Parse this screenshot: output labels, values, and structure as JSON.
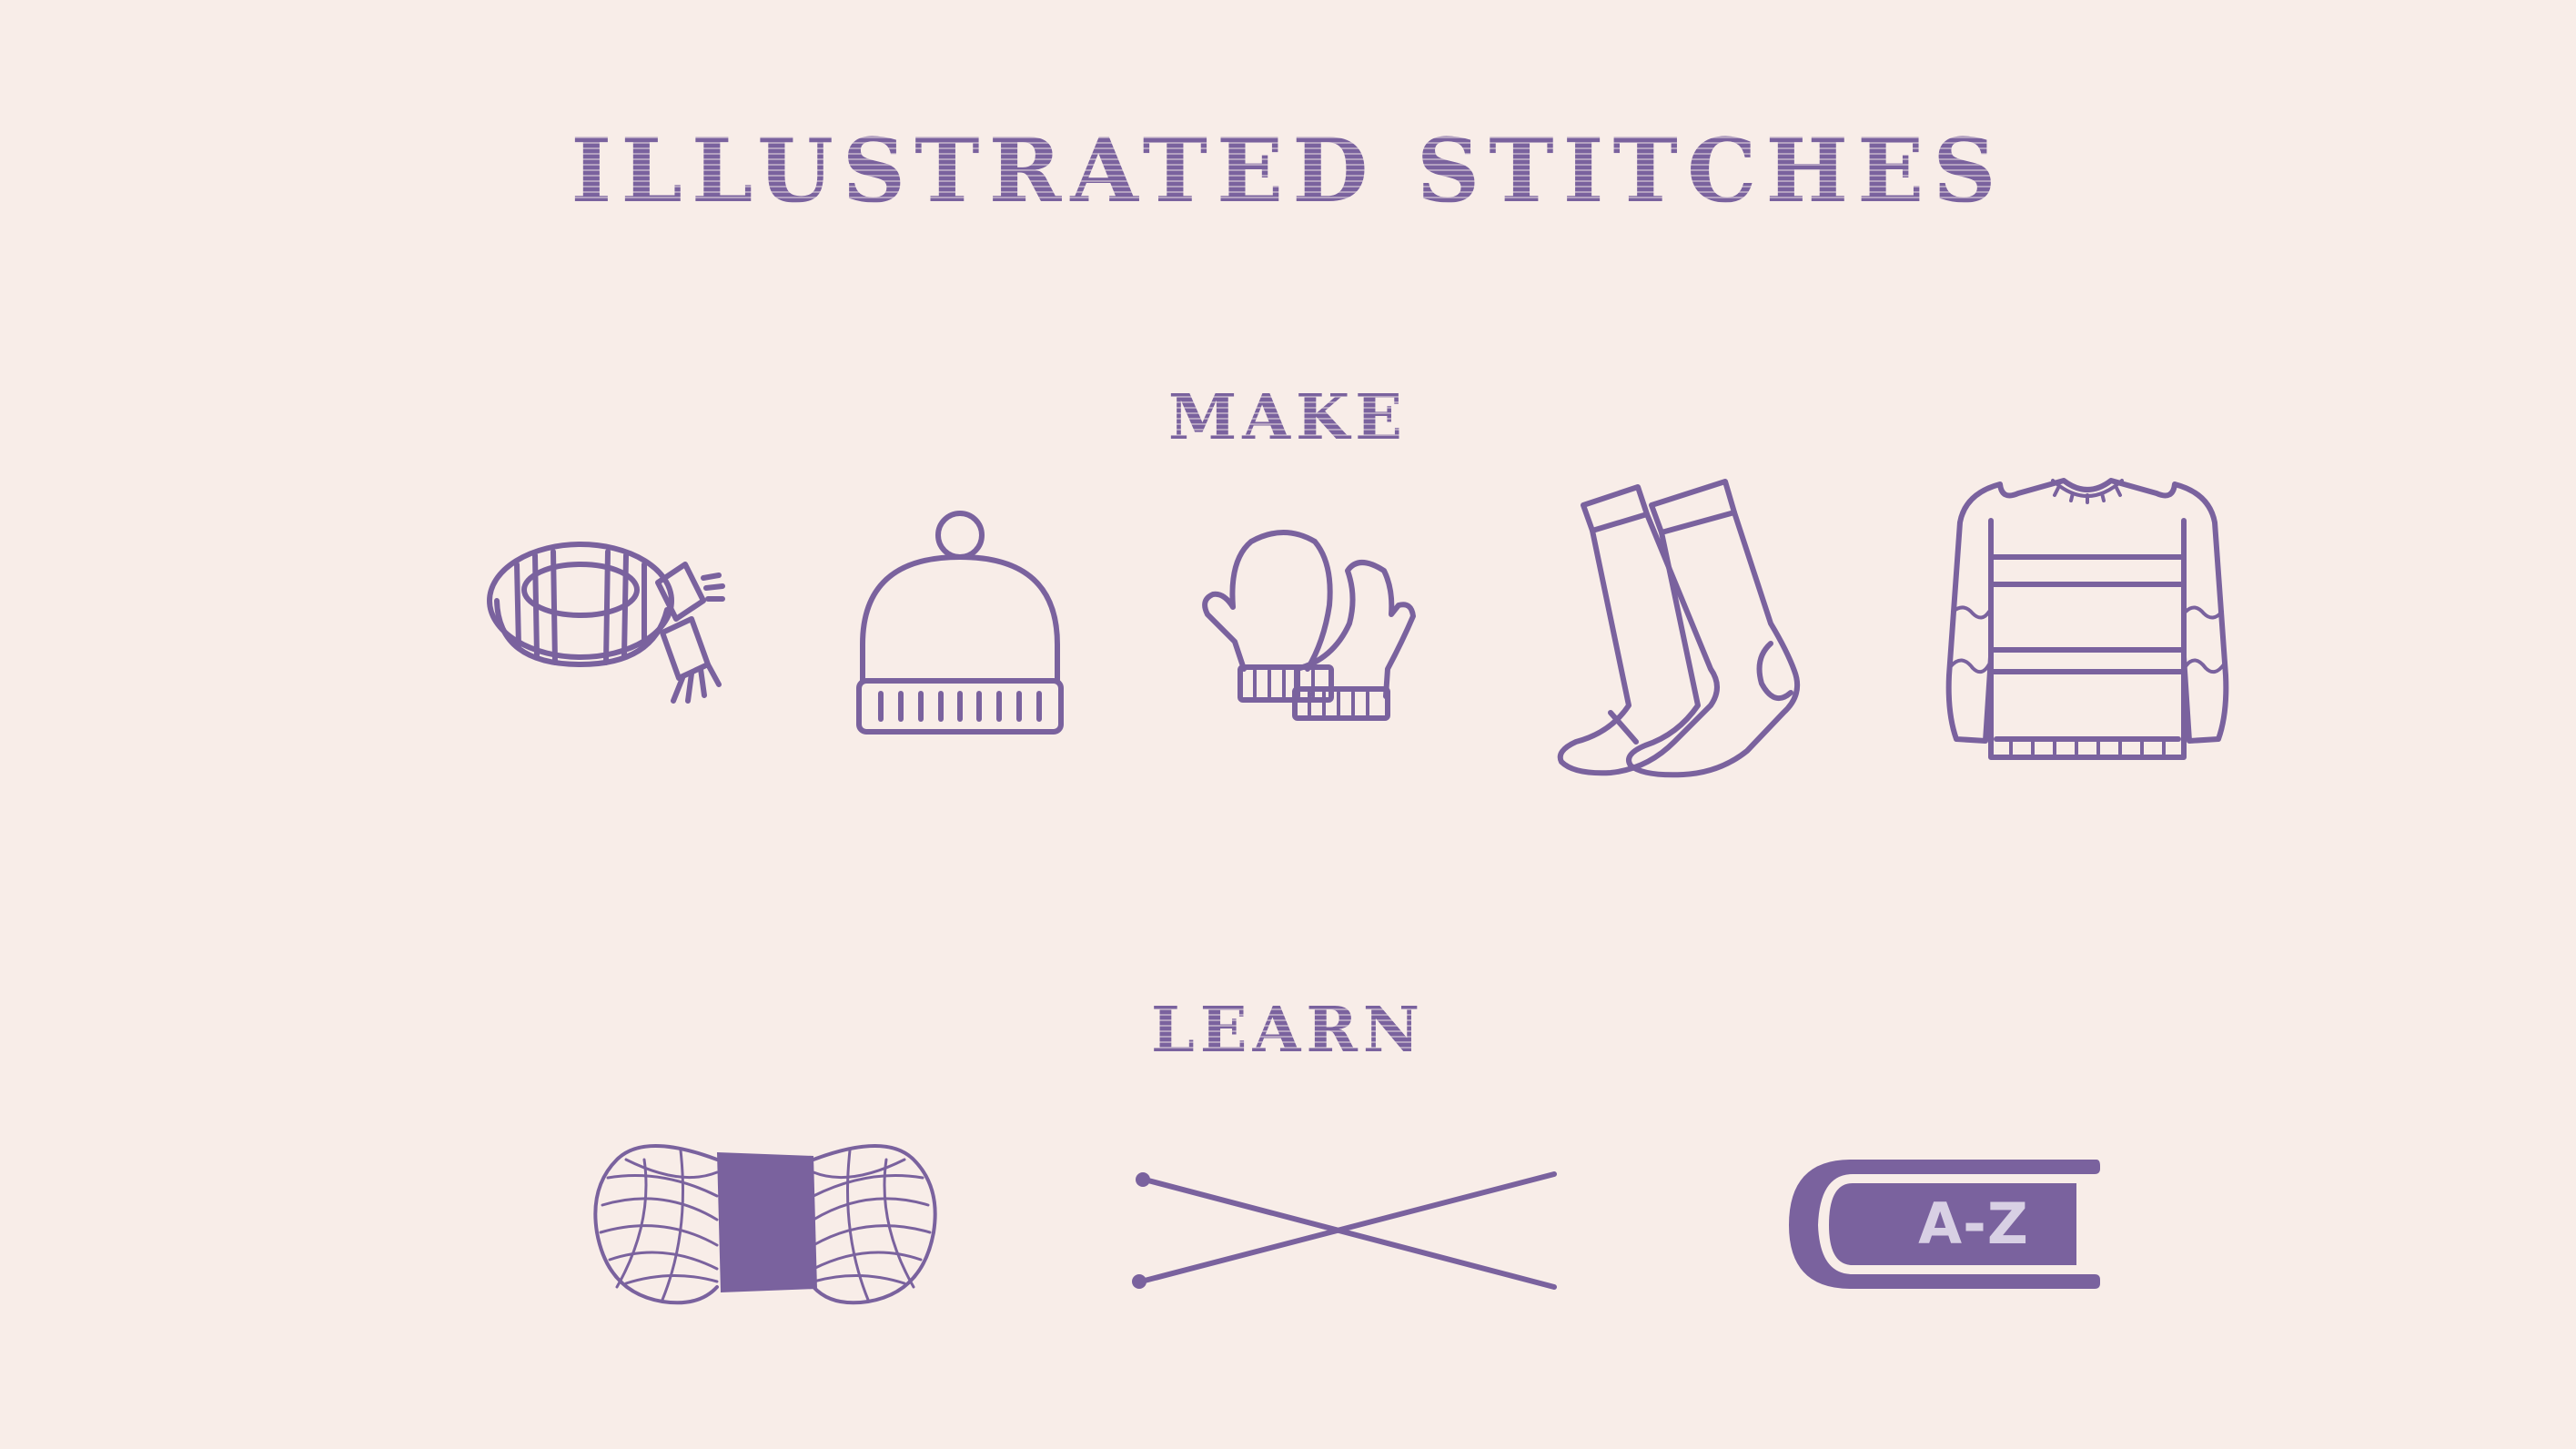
{
  "title": "ILLUSTRATED STITCHES",
  "sections": {
    "make": {
      "heading": "MAKE",
      "icons": [
        "scarf-icon",
        "beanie-hat-icon",
        "mittens-icon",
        "socks-icon",
        "sweater-icon"
      ]
    },
    "learn": {
      "heading": "LEARN",
      "icons": [
        "yarn-skein-icon",
        "knitting-needles-icon",
        "glossary-book-icon"
      ],
      "book_label": "A-Z"
    }
  },
  "colors": {
    "background": "#f8ede8",
    "accent": "#7a629e"
  }
}
